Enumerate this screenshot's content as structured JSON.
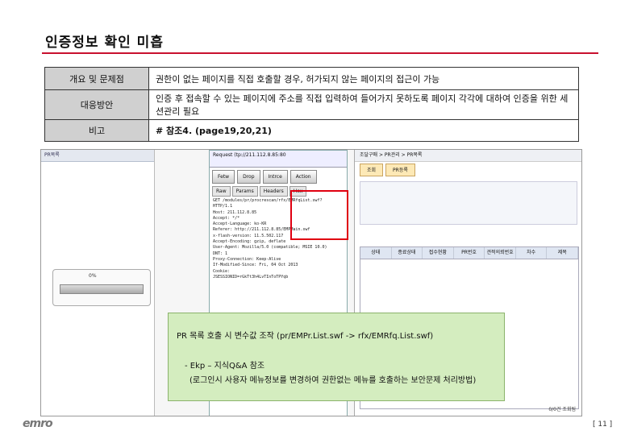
{
  "page_title": "인증정보 확인 미흡",
  "table": {
    "row1": {
      "header": "개요 및 문제점",
      "value": "권한이 없는 페이지를 직접 호출할 경우, 허가되지 않는 페이지의 접근이 가능"
    },
    "row2": {
      "header": "대응방안",
      "value": "인증 후 접속할 수 있는 페이지에 주소를 직접 입력하여 들어가지 못하도록 페이지 각각에 대하여 인증을 위한 세션관리 필요"
    },
    "row3": {
      "header": "비고",
      "value": "# 참조4. (page19,20,21)"
    }
  },
  "screenshot": {
    "left_title": "PR목록",
    "left_progress": "0%",
    "mid_url": "Request (tp://211.112.8.85:80",
    "mid_buttons": [
      "Fetw",
      "Drop",
      "Intrce",
      "Action"
    ],
    "mid_tabs": [
      "Raw",
      "Params",
      "Headers",
      "Hex"
    ],
    "mid_lines": [
      "GET /modules/pr/procrescan/rfx/EMRfqList.swf?",
      "HTTP/1.1",
      "Host: 211.112.8.85",
      "Accept: */*",
      "Accept-Language: ko-KR",
      "Referer: http://211.112.8.85/EMPMain.swf",
      "x-flash-version: 11.5.502.117",
      "Accept-Encoding: gzip, deflate",
      "User-Agent: Mozilla/5.0 (compatible; MSIE 10.0)",
      "DNT: 1",
      "Proxy-Connection: Keep-Alive",
      "If-Modified-Since: Fri, 04 Oct 2013",
      "Cookie:",
      "JSESSIONID=rGkTt3h4LvTInToTPYqb"
    ],
    "right_crumb": "조달구매 > PR관리 > PR목록",
    "right_tabs": [
      "조회",
      "PR등록"
    ],
    "right_cols": [
      "상태",
      "종료상태",
      "접수현황",
      "PR번호",
      "견적의뢰번호",
      "차수",
      "제목"
    ],
    "right_footer": "0/0건 조회됨"
  },
  "callout": {
    "line1": "PR 목록 호출 시 변수값 조작 (pr/EMPr.List.swf -> rfx/EMRfq.List.swf)",
    "line2": "- Ekp – 지식Q&A 참조",
    "line3": "(로그인시 사용자 메뉴정보를 변경하여 권한없는 메뉴를 호출하는 보안문제 처리방법)"
  },
  "footer": {
    "logo": "emro",
    "page": "[ 11 ]"
  }
}
